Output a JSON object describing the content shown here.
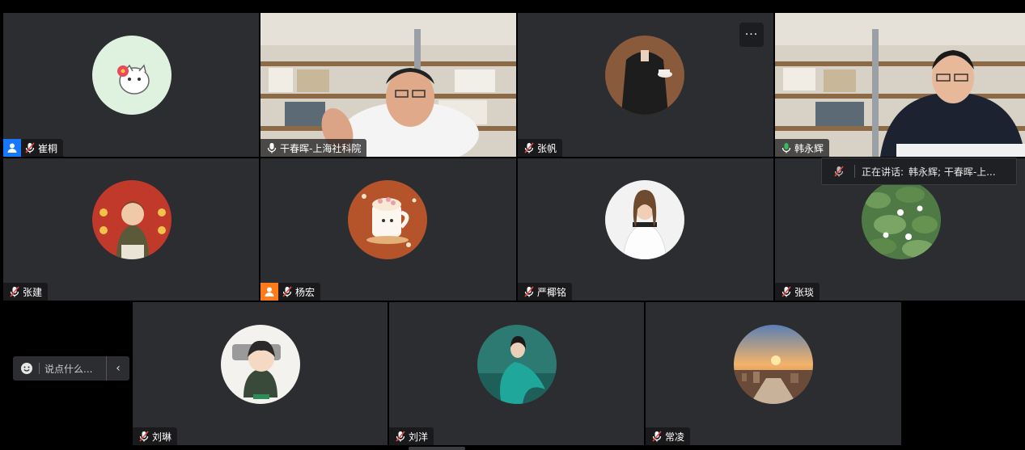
{
  "participants": [
    {
      "name": "崔桐",
      "mic": "muted",
      "badge": "host"
    },
    {
      "name": "干春晖-上海社科院",
      "mic": "on"
    },
    {
      "name": "张帆",
      "mic": "muted"
    },
    {
      "name": "韩永辉",
      "mic": "on-speaking"
    },
    {
      "name": "张建",
      "mic": "muted"
    },
    {
      "name": "杨宏",
      "mic": "muted",
      "badge": "cohost"
    },
    {
      "name": "严椰铭",
      "mic": "muted"
    },
    {
      "name": "张琰",
      "mic": "muted"
    },
    {
      "name": "刘琳",
      "mic": "muted"
    },
    {
      "name": "刘洋",
      "mic": "muted"
    },
    {
      "name": "常凌",
      "mic": "muted"
    }
  ],
  "speaking": {
    "label": "正在讲话:",
    "names": "韩永辉; 干春晖-上..."
  },
  "chat": {
    "placeholder": "说点什么..."
  },
  "more_menu": "···",
  "colors": {
    "tile_bg": "#2b2d31",
    "active_speaker": "#2fbf5b",
    "host_badge": "#1677ff",
    "cohost_badge": "#ff7a1a"
  }
}
